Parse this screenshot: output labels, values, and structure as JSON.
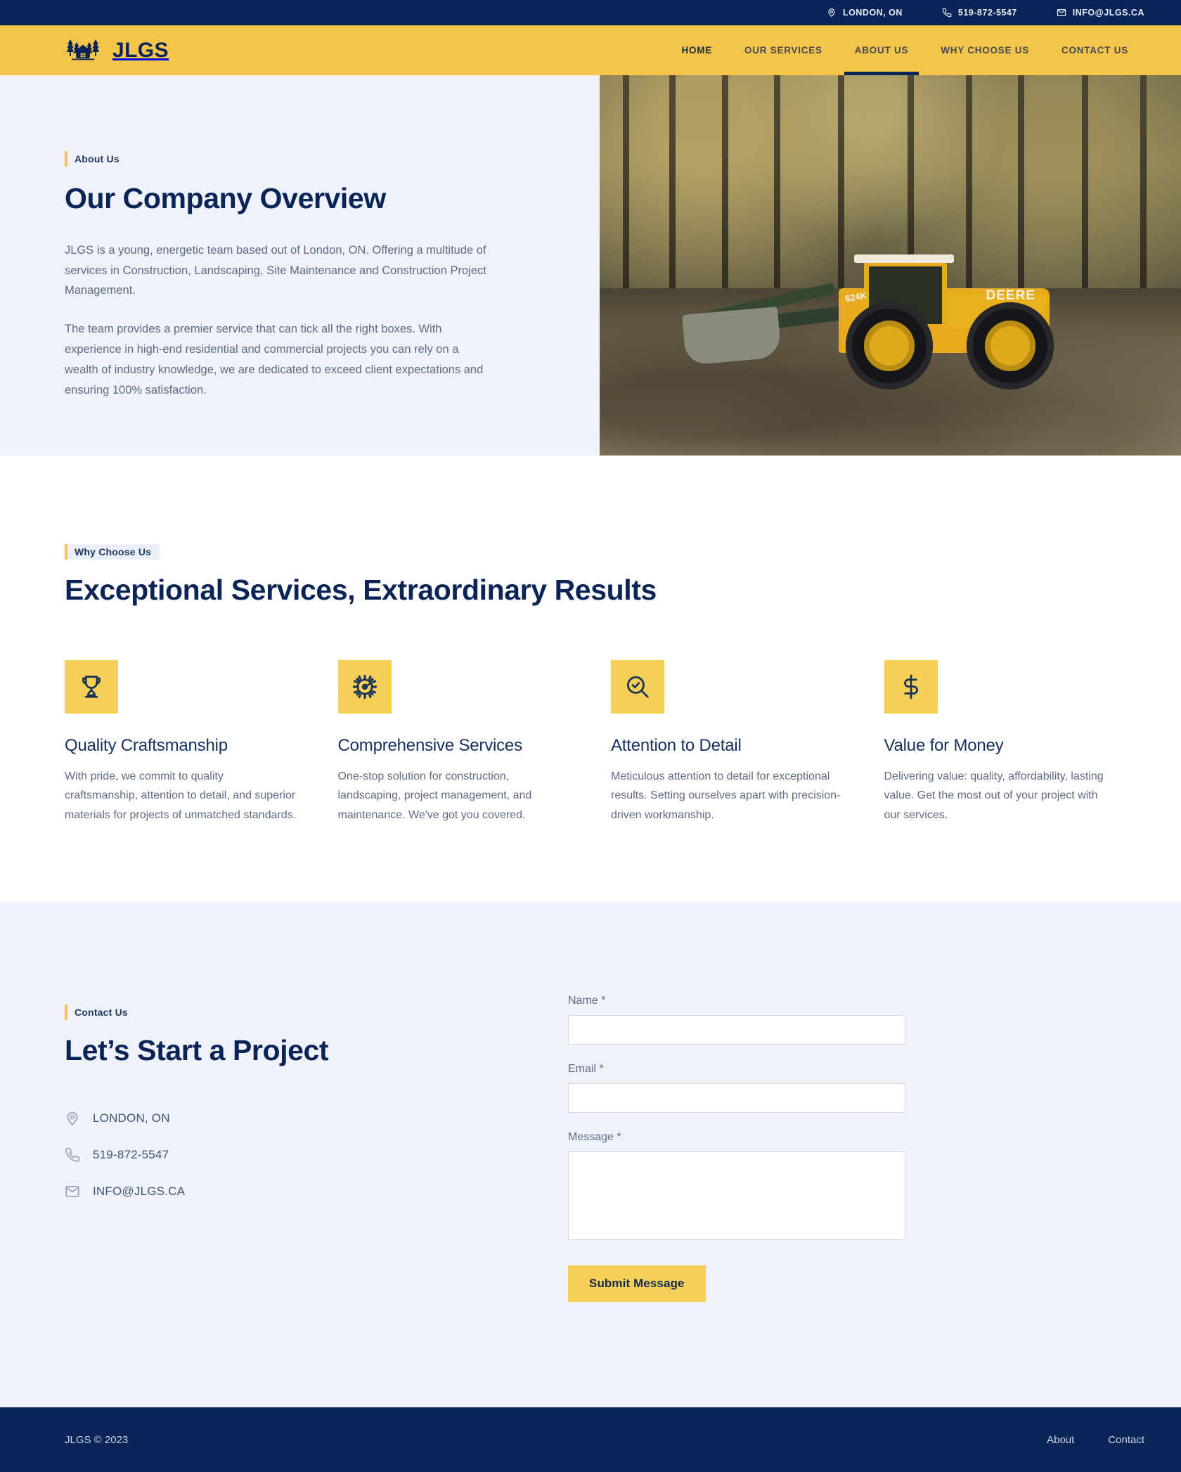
{
  "colors": {
    "navy": "#0a2458",
    "yellow": "#f3c64b",
    "yellow_soft": "#f5cf56",
    "light_bg": "#eff2f8",
    "body_text": "#5e6b85"
  },
  "topbar": {
    "items": [
      {
        "icon": "map-pin-icon",
        "label": "LONDON, ON"
      },
      {
        "icon": "phone-icon",
        "label": "519-872-5547"
      },
      {
        "icon": "envelope-icon",
        "label": "INFO@JLGS.CA"
      }
    ]
  },
  "header": {
    "brand_name": "JLGS",
    "brand_icon": "cabin-trees-logo-icon",
    "nav": [
      {
        "label": "HOME",
        "active": false,
        "home": true
      },
      {
        "label": "OUR SERVICES",
        "active": false,
        "home": false
      },
      {
        "label": "ABOUT US",
        "active": true,
        "home": false
      },
      {
        "label": "WHY CHOOSE US",
        "active": false,
        "home": false
      },
      {
        "label": "CONTACT US",
        "active": false,
        "home": false
      }
    ]
  },
  "about": {
    "eyebrow": "About Us",
    "heading": "Our Company Overview",
    "paragraph1": "JLGS is a young, energetic team based out of London, ON. Offering a multitude of services in Construction, Landscaping, Site Maintenance and Construction Project Management.",
    "paragraph2": "The team provides a premier service that can tick all the right boxes. With experience in high-end residential and commercial projects you can rely on a wealth of industry knowledge, we are dedicated to exceed client expectations and ensuring 100% satisfaction.",
    "image_alt": "Yellow John Deere 624K wheel loader on a dirt site in a forest",
    "image_text": {
      "brand": "DEERE",
      "model": "624K"
    }
  },
  "why": {
    "eyebrow": "Why Choose Us",
    "heading": "Exceptional Services, Extraordinary Results",
    "features": [
      {
        "icon": "trophy-icon",
        "title": "Quality Craftsmanship",
        "desc": "With pride, we commit to quality craftsmanship, attention to detail, and superior materials for projects of unmatched standards."
      },
      {
        "icon": "gear-icon",
        "title": "Comprehensive Services",
        "desc": "One-stop solution for construction, landscaping, project management, and maintenance. We've got you covered."
      },
      {
        "icon": "magnifier-check-icon",
        "title": "Attention to Detail",
        "desc": "Meticulous attention to detail for exceptional results. Setting ourselves apart with precision-driven workmanship."
      },
      {
        "icon": "dollar-sign-icon",
        "title": "Value for Money",
        "desc": "Delivering value: quality, affordability, lasting value. Get the most out of your project with our services."
      }
    ]
  },
  "contact": {
    "eyebrow": "Contact Us",
    "heading": "Let’s Start a Project",
    "details": [
      {
        "icon": "map-pin-icon",
        "label": "LONDON, ON"
      },
      {
        "icon": "phone-icon",
        "label": "519-872-5547"
      },
      {
        "icon": "envelope-icon",
        "label": "INFO@JLGS.CA"
      }
    ],
    "form": {
      "name_label": "Name *",
      "name_value": "",
      "name_placeholder": "",
      "email_label": "Email *",
      "email_value": "",
      "email_placeholder": "",
      "message_label": "Message *",
      "message_value": "",
      "message_placeholder": "",
      "submit_label": "Submit Message"
    }
  },
  "footer": {
    "copyright": "JLGS © 2023",
    "links": [
      {
        "label": "About"
      },
      {
        "label": "Contact"
      }
    ]
  }
}
